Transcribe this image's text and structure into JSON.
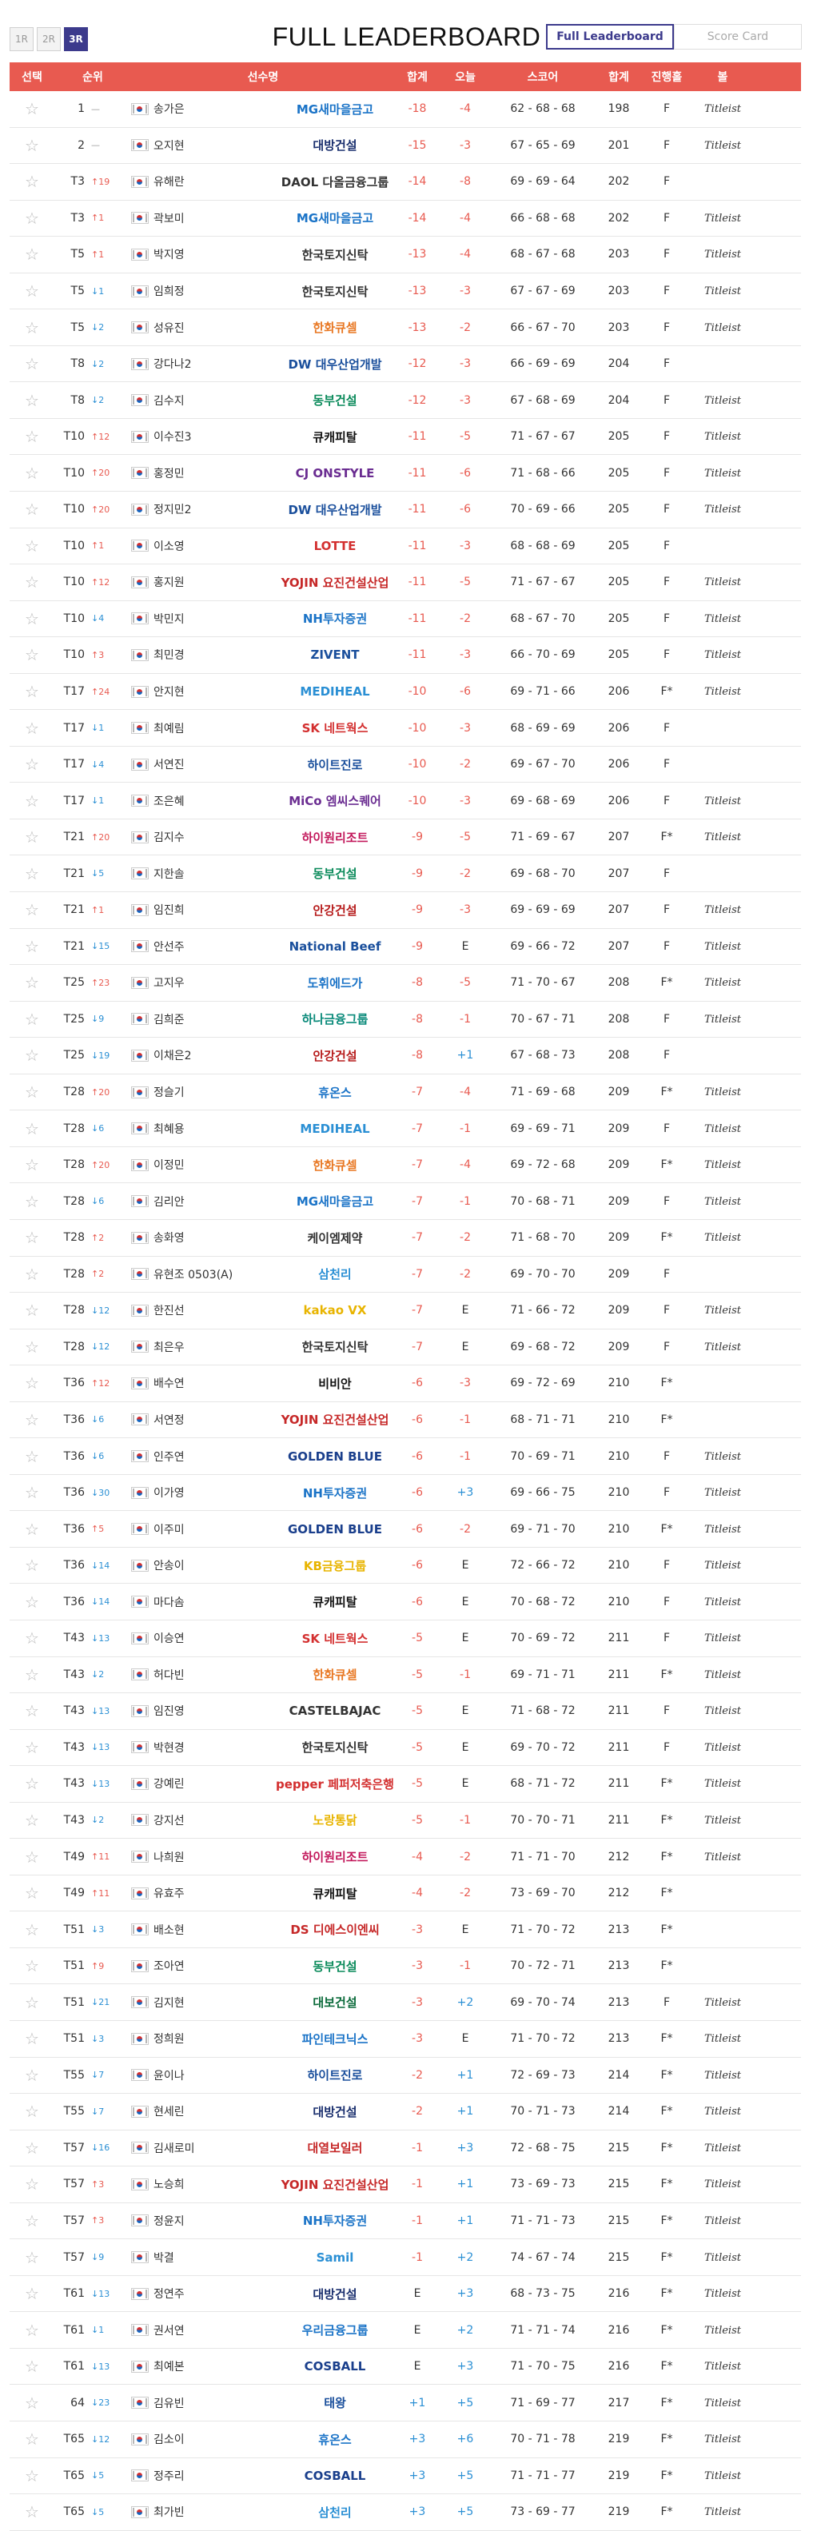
{
  "rounds": [
    "1R",
    "2R",
    "3R"
  ],
  "active_round": "3R",
  "title": "FULL LEADERBOARD",
  "view_tabs": [
    "Full Leaderboard",
    "Score Card"
  ],
  "headers": {
    "select": "선택",
    "rank": "순위",
    "player": "선수명",
    "total": "합계",
    "today": "오늘",
    "score": "스코어",
    "sum": "합계",
    "status": "진행홀",
    "ball": "볼"
  },
  "rows": [
    {
      "rank": "1",
      "move": "—",
      "dir": "same",
      "name": "송가은",
      "sponsor": "MG새마을금고",
      "sc": "#1a73c7",
      "total": "-18",
      "today": "-4",
      "score": "62 - 68 - 68",
      "sum": "198",
      "status": "F",
      "ball": "Titleist"
    },
    {
      "rank": "2",
      "move": "—",
      "dir": "same",
      "name": "오지현",
      "sponsor": "대방건설",
      "sc": "#1a2f6e",
      "total": "-15",
      "today": "-3",
      "score": "67 - 65 - 69",
      "sum": "201",
      "status": "F",
      "ball": "Titleist"
    },
    {
      "rank": "T3",
      "move": "19",
      "dir": "up",
      "name": "유해란",
      "sponsor": "DAOL 다올금융그룹",
      "sc": "#333333",
      "total": "-14",
      "today": "-8",
      "score": "69 - 69 - 64",
      "sum": "202",
      "status": "F",
      "ball": ""
    },
    {
      "rank": "T3",
      "move": "1",
      "dir": "up",
      "name": "곽보미",
      "sponsor": "MG새마을금고",
      "sc": "#1a73c7",
      "total": "-14",
      "today": "-4",
      "score": "66 - 68 - 68",
      "sum": "202",
      "status": "F",
      "ball": "Titleist"
    },
    {
      "rank": "T5",
      "move": "1",
      "dir": "up",
      "name": "박지영",
      "sponsor": "한국토지신탁",
      "sc": "#333333",
      "total": "-13",
      "today": "-4",
      "score": "68 - 67 - 68",
      "sum": "203",
      "status": "F",
      "ball": "Titleist"
    },
    {
      "rank": "T5",
      "move": "1",
      "dir": "down",
      "name": "임희정",
      "sponsor": "한국토지신탁",
      "sc": "#333333",
      "total": "-13",
      "today": "-3",
      "score": "67 - 67 - 69",
      "sum": "203",
      "status": "F",
      "ball": "Titleist"
    },
    {
      "rank": "T5",
      "move": "2",
      "dir": "down",
      "name": "성유진",
      "sponsor": "한화큐셀",
      "sc": "#e87722",
      "total": "-13",
      "today": "-2",
      "score": "66 - 67 - 70",
      "sum": "203",
      "status": "F",
      "ball": "Titleist"
    },
    {
      "rank": "T8",
      "move": "2",
      "dir": "down",
      "name": "강다나2",
      "sponsor": "DW 대우산업개발",
      "sc": "#1a4f9c",
      "total": "-12",
      "today": "-3",
      "score": "66 - 69 - 69",
      "sum": "204",
      "status": "F",
      "ball": ""
    },
    {
      "rank": "T8",
      "move": "2",
      "dir": "down",
      "name": "김수지",
      "sponsor": "동부건설",
      "sc": "#0a8a5a",
      "total": "-12",
      "today": "-3",
      "score": "67 - 68 - 69",
      "sum": "204",
      "status": "F",
      "ball": "Titleist"
    },
    {
      "rank": "T10",
      "move": "12",
      "dir": "up",
      "name": "이수진3",
      "sponsor": "큐캐피탈",
      "sc": "#111111",
      "total": "-11",
      "today": "-5",
      "score": "71 - 67 - 67",
      "sum": "205",
      "status": "F",
      "ball": "Titleist"
    },
    {
      "rank": "T10",
      "move": "20",
      "dir": "up",
      "name": "홍정민",
      "sponsor": "CJ ONSTYLE",
      "sc": "#6a2c91",
      "total": "-11",
      "today": "-6",
      "score": "71 - 68 - 66",
      "sum": "205",
      "status": "F",
      "ball": "Titleist"
    },
    {
      "rank": "T10",
      "move": "20",
      "dir": "up",
      "name": "정지민2",
      "sponsor": "DW 대우산업개발",
      "sc": "#1a4f9c",
      "total": "-11",
      "today": "-6",
      "score": "70 - 69 - 66",
      "sum": "205",
      "status": "F",
      "ball": "Titleist"
    },
    {
      "rank": "T10",
      "move": "1",
      "dir": "up",
      "name": "이소영",
      "sponsor": "LOTTE",
      "sc": "#d32f2f",
      "total": "-11",
      "today": "-3",
      "score": "68 - 68 - 69",
      "sum": "205",
      "status": "F",
      "ball": ""
    },
    {
      "rank": "T10",
      "move": "12",
      "dir": "up",
      "name": "홍지원",
      "sponsor": "YOJIN 요진건설산업",
      "sc": "#c62828",
      "total": "-11",
      "today": "-5",
      "score": "71 - 67 - 67",
      "sum": "205",
      "status": "F",
      "ball": "Titleist"
    },
    {
      "rank": "T10",
      "move": "4",
      "dir": "down",
      "name": "박민지",
      "sponsor": "NH투자증권",
      "sc": "#1a73c7",
      "total": "-11",
      "today": "-2",
      "score": "68 - 67 - 70",
      "sum": "205",
      "status": "F",
      "ball": "Titleist"
    },
    {
      "rank": "T10",
      "move": "3",
      "dir": "up",
      "name": "최민경",
      "sponsor": "ZIVENT",
      "sc": "#1a4f9c",
      "total": "-11",
      "today": "-3",
      "score": "66 - 70 - 69",
      "sum": "205",
      "status": "F",
      "ball": "Titleist"
    },
    {
      "rank": "T17",
      "move": "24",
      "dir": "up",
      "name": "안지현",
      "sponsor": "MEDIHEAL",
      "sc": "#2a8fd4",
      "total": "-10",
      "today": "-6",
      "score": "69 - 71 - 66",
      "sum": "206",
      "status": "F*",
      "ball": "Titleist"
    },
    {
      "rank": "T17",
      "move": "1",
      "dir": "down",
      "name": "최예림",
      "sponsor": "SK 네트웍스",
      "sc": "#d32f2f",
      "total": "-10",
      "today": "-3",
      "score": "68 - 69 - 69",
      "sum": "206",
      "status": "F",
      "ball": ""
    },
    {
      "rank": "T17",
      "move": "4",
      "dir": "down",
      "name": "서연진",
      "sponsor": "하이트진로",
      "sc": "#1a4f9c",
      "total": "-10",
      "today": "-2",
      "score": "69 - 67 - 70",
      "sum": "206",
      "status": "F",
      "ball": ""
    },
    {
      "rank": "T17",
      "move": "1",
      "dir": "down",
      "name": "조은혜",
      "sponsor": "MiCo 엠씨스퀘어",
      "sc": "#6a2c91",
      "total": "-10",
      "today": "-3",
      "score": "69 - 68 - 69",
      "sum": "206",
      "status": "F",
      "ball": "Titleist"
    },
    {
      "rank": "T21",
      "move": "20",
      "dir": "up",
      "name": "김지수",
      "sponsor": "하이원리조트",
      "sc": "#c2185b",
      "total": "-9",
      "today": "-5",
      "score": "71 - 69 - 67",
      "sum": "207",
      "status": "F*",
      "ball": "Titleist"
    },
    {
      "rank": "T21",
      "move": "5",
      "dir": "down",
      "name": "지한솔",
      "sponsor": "동부건설",
      "sc": "#0a8a5a",
      "total": "-9",
      "today": "-2",
      "score": "69 - 68 - 70",
      "sum": "207",
      "status": "F",
      "ball": ""
    },
    {
      "rank": "T21",
      "move": "1",
      "dir": "up",
      "name": "임진희",
      "sponsor": "안강건설",
      "sc": "#b71c1c",
      "total": "-9",
      "today": "-3",
      "score": "69 - 69 - 69",
      "sum": "207",
      "status": "F",
      "ball": "Titleist"
    },
    {
      "rank": "T21",
      "move": "15",
      "dir": "down",
      "name": "안선주",
      "sponsor": "National Beef",
      "sc": "#1a4f9c",
      "total": "-9",
      "today": "E",
      "score": "69 - 66 - 72",
      "sum": "207",
      "status": "F",
      "ball": "Titleist"
    },
    {
      "rank": "T25",
      "move": "23",
      "dir": "up",
      "name": "고지우",
      "sponsor": "도휘에드가",
      "sc": "#1a73c7",
      "total": "-8",
      "today": "-5",
      "score": "71 - 70 - 67",
      "sum": "208",
      "status": "F*",
      "ball": "Titleist"
    },
    {
      "rank": "T25",
      "move": "9",
      "dir": "down",
      "name": "김희준",
      "sponsor": "하나금융그룹",
      "sc": "#0a8a7a",
      "total": "-8",
      "today": "-1",
      "score": "70 - 67 - 71",
      "sum": "208",
      "status": "F",
      "ball": "Titleist"
    },
    {
      "rank": "T25",
      "move": "19",
      "dir": "down",
      "name": "이채은2",
      "sponsor": "안강건설",
      "sc": "#b71c1c",
      "total": "-8",
      "today": "+1",
      "score": "67 - 68 - 73",
      "sum": "208",
      "status": "F",
      "ball": ""
    },
    {
      "rank": "T28",
      "move": "20",
      "dir": "up",
      "name": "정슬기",
      "sponsor": "휴온스",
      "sc": "#1a73c7",
      "total": "-7",
      "today": "-4",
      "score": "71 - 69 - 68",
      "sum": "209",
      "status": "F*",
      "ball": "Titleist"
    },
    {
      "rank": "T28",
      "move": "6",
      "dir": "down",
      "name": "최혜용",
      "sponsor": "MEDIHEAL",
      "sc": "#2a8fd4",
      "total": "-7",
      "today": "-1",
      "score": "69 - 69 - 71",
      "sum": "209",
      "status": "F",
      "ball": "Titleist"
    },
    {
      "rank": "T28",
      "move": "20",
      "dir": "up",
      "name": "이정민",
      "sponsor": "한화큐셀",
      "sc": "#e87722",
      "total": "-7",
      "today": "-4",
      "score": "69 - 72 - 68",
      "sum": "209",
      "status": "F*",
      "ball": "Titleist"
    },
    {
      "rank": "T28",
      "move": "6",
      "dir": "down",
      "name": "김리안",
      "sponsor": "MG새마을금고",
      "sc": "#1a73c7",
      "total": "-7",
      "today": "-1",
      "score": "70 - 68 - 71",
      "sum": "209",
      "status": "F",
      "ball": "Titleist"
    },
    {
      "rank": "T28",
      "move": "2",
      "dir": "up",
      "name": "송화영",
      "sponsor": "케이엠제약",
      "sc": "#333333",
      "total": "-7",
      "today": "-2",
      "score": "71 - 68 - 70",
      "sum": "209",
      "status": "F*",
      "ball": "Titleist"
    },
    {
      "rank": "T28",
      "move": "2",
      "dir": "up",
      "name": "유현조 0503(A)",
      "sponsor": "삼천리",
      "sc": "#2a8fd4",
      "total": "-7",
      "today": "-2",
      "score": "69 - 70 - 70",
      "sum": "209",
      "status": "F",
      "ball": ""
    },
    {
      "rank": "T28",
      "move": "12",
      "dir": "down",
      "name": "한진선",
      "sponsor": "kakao VX",
      "sc": "#e8b400",
      "total": "-7",
      "today": "E",
      "score": "71 - 66 - 72",
      "sum": "209",
      "status": "F",
      "ball": "Titleist"
    },
    {
      "rank": "T28",
      "move": "12",
      "dir": "down",
      "name": "최은우",
      "sponsor": "한국토지신탁",
      "sc": "#333333",
      "total": "-7",
      "today": "E",
      "score": "69 - 68 - 72",
      "sum": "209",
      "status": "F",
      "ball": "Titleist"
    },
    {
      "rank": "T36",
      "move": "12",
      "dir": "up",
      "name": "배수연",
      "sponsor": "비비안",
      "sc": "#111111",
      "total": "-6",
      "today": "-3",
      "score": "69 - 72 - 69",
      "sum": "210",
      "status": "F*",
      "ball": ""
    },
    {
      "rank": "T36",
      "move": "6",
      "dir": "down",
      "name": "서연정",
      "sponsor": "YOJIN 요진건설산업",
      "sc": "#c62828",
      "total": "-6",
      "today": "-1",
      "score": "68 - 71 - 71",
      "sum": "210",
      "status": "F*",
      "ball": ""
    },
    {
      "rank": "T36",
      "move": "6",
      "dir": "down",
      "name": "인주연",
      "sponsor": "GOLDEN BLUE",
      "sc": "#1a3f8c",
      "total": "-6",
      "today": "-1",
      "score": "70 - 69 - 71",
      "sum": "210",
      "status": "F",
      "ball": "Titleist"
    },
    {
      "rank": "T36",
      "move": "30",
      "dir": "down",
      "name": "이가영",
      "sponsor": "NH투자증권",
      "sc": "#1a73c7",
      "total": "-6",
      "today": "+3",
      "score": "69 - 66 - 75",
      "sum": "210",
      "status": "F",
      "ball": "Titleist"
    },
    {
      "rank": "T36",
      "move": "5",
      "dir": "up",
      "name": "이주미",
      "sponsor": "GOLDEN BLUE",
      "sc": "#1a3f8c",
      "total": "-6",
      "today": "-2",
      "score": "69 - 71 - 70",
      "sum": "210",
      "status": "F*",
      "ball": "Titleist"
    },
    {
      "rank": "T36",
      "move": "14",
      "dir": "down",
      "name": "안송이",
      "sponsor": "KB금융그룹",
      "sc": "#e8b400",
      "total": "-6",
      "today": "E",
      "score": "72 - 66 - 72",
      "sum": "210",
      "status": "F",
      "ball": "Titleist"
    },
    {
      "rank": "T36",
      "move": "14",
      "dir": "down",
      "name": "마다솜",
      "sponsor": "큐캐피탈",
      "sc": "#111111",
      "total": "-6",
      "today": "E",
      "score": "70 - 68 - 72",
      "sum": "210",
      "status": "F",
      "ball": "Titleist"
    },
    {
      "rank": "T43",
      "move": "13",
      "dir": "down",
      "name": "이승연",
      "sponsor": "SK 네트웍스",
      "sc": "#d32f2f",
      "total": "-5",
      "today": "E",
      "score": "70 - 69 - 72",
      "sum": "211",
      "status": "F",
      "ball": "Titleist"
    },
    {
      "rank": "T43",
      "move": "2",
      "dir": "down",
      "name": "허다빈",
      "sponsor": "한화큐셀",
      "sc": "#e87722",
      "total": "-5",
      "today": "-1",
      "score": "69 - 71 - 71",
      "sum": "211",
      "status": "F*",
      "ball": "Titleist"
    },
    {
      "rank": "T43",
      "move": "13",
      "dir": "down",
      "name": "임진영",
      "sponsor": "CASTELBAJAC",
      "sc": "#333333",
      "total": "-5",
      "today": "E",
      "score": "71 - 68 - 72",
      "sum": "211",
      "status": "F",
      "ball": "Titleist"
    },
    {
      "rank": "T43",
      "move": "13",
      "dir": "down",
      "name": "박현경",
      "sponsor": "한국토지신탁",
      "sc": "#333333",
      "total": "-5",
      "today": "E",
      "score": "69 - 70 - 72",
      "sum": "211",
      "status": "F",
      "ball": "Titleist"
    },
    {
      "rank": "T43",
      "move": "13",
      "dir": "down",
      "name": "강예린",
      "sponsor": "pepper 페퍼저축은행",
      "sc": "#d32f2f",
      "total": "-5",
      "today": "E",
      "score": "68 - 71 - 72",
      "sum": "211",
      "status": "F*",
      "ball": "Titleist"
    },
    {
      "rank": "T43",
      "move": "2",
      "dir": "down",
      "name": "강지선",
      "sponsor": "노랑통닭",
      "sc": "#e8b400",
      "total": "-5",
      "today": "-1",
      "score": "70 - 70 - 71",
      "sum": "211",
      "status": "F*",
      "ball": "Titleist"
    },
    {
      "rank": "T49",
      "move": "11",
      "dir": "up",
      "name": "나희원",
      "sponsor": "하이원리조트",
      "sc": "#c2185b",
      "total": "-4",
      "today": "-2",
      "score": "71 - 71 - 70",
      "sum": "212",
      "status": "F*",
      "ball": "Titleist"
    },
    {
      "rank": "T49",
      "move": "11",
      "dir": "up",
      "name": "유효주",
      "sponsor": "큐캐피탈",
      "sc": "#111111",
      "total": "-4",
      "today": "-2",
      "score": "73 - 69 - 70",
      "sum": "212",
      "status": "F*",
      "ball": ""
    },
    {
      "rank": "T51",
      "move": "3",
      "dir": "down",
      "name": "배소현",
      "sponsor": "DS 디에스이엔씨",
      "sc": "#c62828",
      "total": "-3",
      "today": "E",
      "score": "71 - 70 - 72",
      "sum": "213",
      "status": "F*",
      "ball": ""
    },
    {
      "rank": "T51",
      "move": "9",
      "dir": "up",
      "name": "조아연",
      "sponsor": "동부건설",
      "sc": "#0a8a5a",
      "total": "-3",
      "today": "-1",
      "score": "70 - 72 - 71",
      "sum": "213",
      "status": "F*",
      "ball": ""
    },
    {
      "rank": "T51",
      "move": "21",
      "dir": "down",
      "name": "김지현",
      "sponsor": "대보건설",
      "sc": "#0a6a3a",
      "total": "-3",
      "today": "+2",
      "score": "69 - 70 - 74",
      "sum": "213",
      "status": "F",
      "ball": "Titleist"
    },
    {
      "rank": "T51",
      "move": "3",
      "dir": "down",
      "name": "정희원",
      "sponsor": "파인테크닉스",
      "sc": "#1a73c7",
      "total": "-3",
      "today": "E",
      "score": "71 - 70 - 72",
      "sum": "213",
      "status": "F*",
      "ball": "Titleist"
    },
    {
      "rank": "T55",
      "move": "7",
      "dir": "down",
      "name": "윤이나",
      "sponsor": "하이트진로",
      "sc": "#1a4f9c",
      "total": "-2",
      "today": "+1",
      "score": "72 - 69 - 73",
      "sum": "214",
      "status": "F*",
      "ball": "Titleist"
    },
    {
      "rank": "T55",
      "move": "7",
      "dir": "down",
      "name": "현세린",
      "sponsor": "대방건설",
      "sc": "#1a2f6e",
      "total": "-2",
      "today": "+1",
      "score": "70 - 71 - 73",
      "sum": "214",
      "status": "F*",
      "ball": "Titleist"
    },
    {
      "rank": "T57",
      "move": "16",
      "dir": "down",
      "name": "김새로미",
      "sponsor": "대열보일러",
      "sc": "#c62828",
      "total": "-1",
      "today": "+3",
      "score": "72 - 68 - 75",
      "sum": "215",
      "status": "F*",
      "ball": "Titleist"
    },
    {
      "rank": "T57",
      "move": "3",
      "dir": "up",
      "name": "노승희",
      "sponsor": "YOJIN 요진건설산업",
      "sc": "#c62828",
      "total": "-1",
      "today": "+1",
      "score": "73 - 69 - 73",
      "sum": "215",
      "status": "F*",
      "ball": "Titleist"
    },
    {
      "rank": "T57",
      "move": "3",
      "dir": "up",
      "name": "정윤지",
      "sponsor": "NH투자증권",
      "sc": "#1a73c7",
      "total": "-1",
      "today": "+1",
      "score": "71 - 71 - 73",
      "sum": "215",
      "status": "F*",
      "ball": "Titleist"
    },
    {
      "rank": "T57",
      "move": "9",
      "dir": "down",
      "name": "박결",
      "sponsor": "Samil",
      "sc": "#2a8fd4",
      "total": "-1",
      "today": "+2",
      "score": "74 - 67 - 74",
      "sum": "215",
      "status": "F*",
      "ball": "Titleist"
    },
    {
      "rank": "T61",
      "move": "13",
      "dir": "down",
      "name": "정연주",
      "sponsor": "대방건설",
      "sc": "#1a2f6e",
      "total": "E",
      "today": "+3",
      "score": "68 - 73 - 75",
      "sum": "216",
      "status": "F*",
      "ball": "Titleist"
    },
    {
      "rank": "T61",
      "move": "1",
      "dir": "down",
      "name": "권서연",
      "sponsor": "우리금융그룹",
      "sc": "#1a73c7",
      "total": "E",
      "today": "+2",
      "score": "71 - 71 - 74",
      "sum": "216",
      "status": "F*",
      "ball": "Titleist"
    },
    {
      "rank": "T61",
      "move": "13",
      "dir": "down",
      "name": "최예본",
      "sponsor": "COSBALL",
      "sc": "#1a3f8c",
      "total": "E",
      "today": "+3",
      "score": "71 - 70 - 75",
      "sum": "216",
      "status": "F*",
      "ball": "Titleist"
    },
    {
      "rank": "64",
      "move": "23",
      "dir": "down",
      "name": "김유빈",
      "sponsor": "태왕",
      "sc": "#1a4f9c",
      "total": "+1",
      "today": "+5",
      "score": "71 - 69 - 77",
      "sum": "217",
      "status": "F*",
      "ball": "Titleist"
    },
    {
      "rank": "T65",
      "move": "12",
      "dir": "down",
      "name": "김소이",
      "sponsor": "휴온스",
      "sc": "#1a73c7",
      "total": "+3",
      "today": "+6",
      "score": "70 - 71 - 78",
      "sum": "219",
      "status": "F*",
      "ball": "Titleist"
    },
    {
      "rank": "T65",
      "move": "5",
      "dir": "down",
      "name": "정주리",
      "sponsor": "COSBALL",
      "sc": "#1a3f8c",
      "total": "+3",
      "today": "+5",
      "score": "71 - 71 - 77",
      "sum": "219",
      "status": "F*",
      "ball": "Titleist"
    },
    {
      "rank": "T65",
      "move": "5",
      "dir": "down",
      "name": "최가빈",
      "sponsor": "삼천리",
      "sc": "#2a8fd4",
      "total": "+3",
      "today": "+5",
      "score": "73 - 69 - 77",
      "sum": "219",
      "status": "F*",
      "ball": "Titleist"
    }
  ]
}
